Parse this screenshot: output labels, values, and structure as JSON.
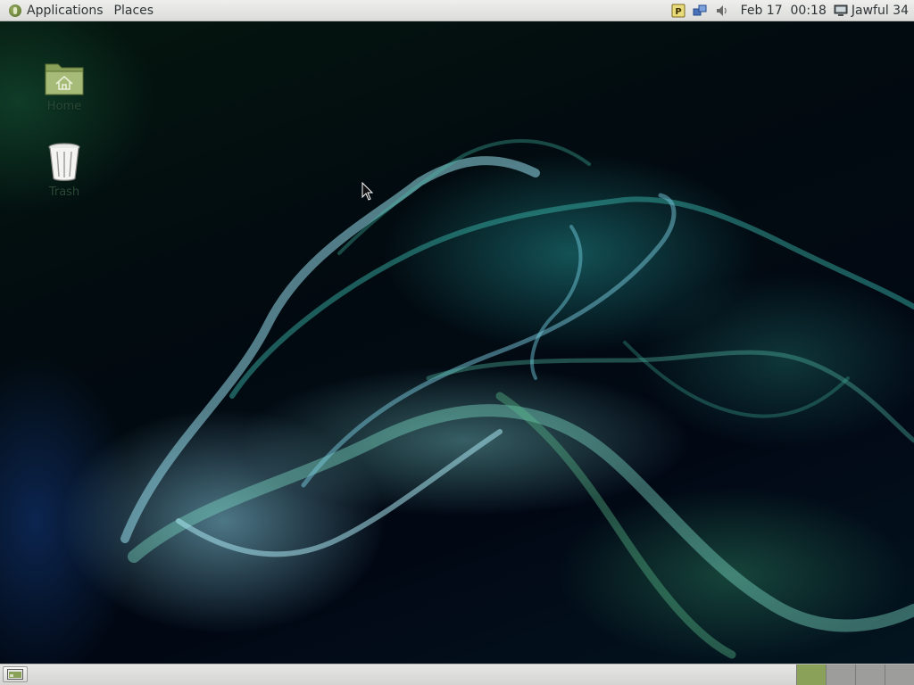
{
  "top_panel": {
    "menus": [
      {
        "label": "Applications",
        "icon": "distro-logo-icon"
      },
      {
        "label": "Places"
      }
    ],
    "tray": {
      "icons": [
        "package-updater-icon",
        "network-icon",
        "volume-icon"
      ],
      "clock": "Feb 17  00:18",
      "user": {
        "icon": "computer-icon",
        "label": "Jawful 34"
      }
    }
  },
  "desktop": {
    "icons": [
      {
        "label": "Home",
        "icon": "home-folder-icon"
      },
      {
        "label": "Trash",
        "icon": "trash-icon"
      }
    ]
  },
  "bottom_panel": {
    "show_desktop_icon": "show-desktop-icon",
    "workspaces": [
      {
        "index": 1,
        "active": true
      },
      {
        "index": 2,
        "active": false
      },
      {
        "index": 3,
        "active": false
      },
      {
        "index": 4,
        "active": false
      }
    ]
  },
  "colors": {
    "panel_bg": "#e6e6e4",
    "accent_green": "#8aa15a",
    "workspace_inactive": "#9d9d9b"
  }
}
